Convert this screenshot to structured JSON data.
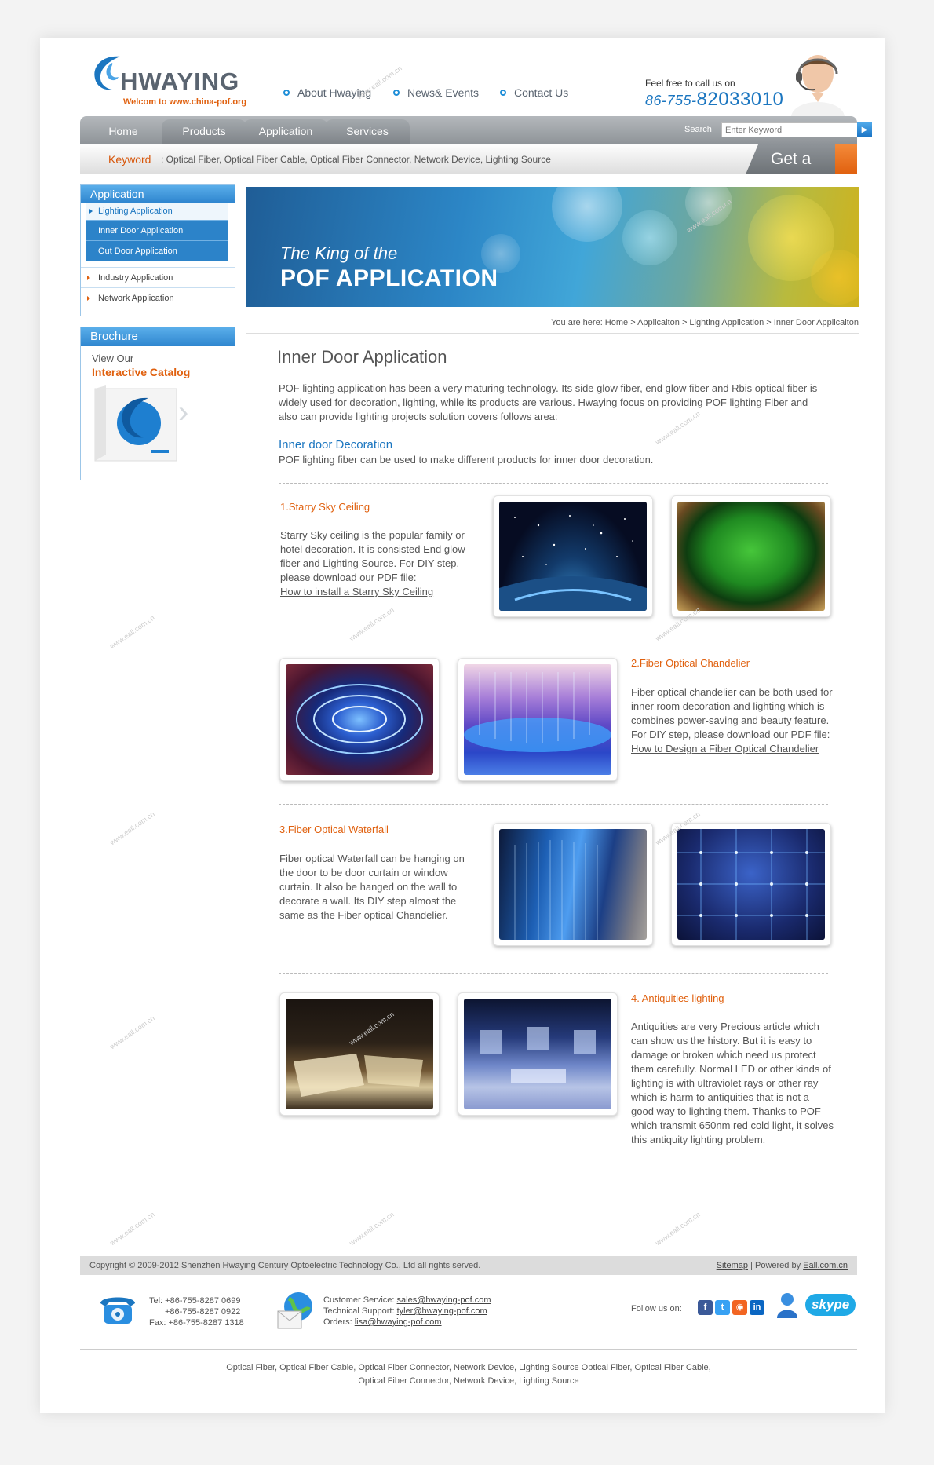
{
  "brand": {
    "name": "HWAYING",
    "welcome": "Welcom to www.china-pof.org"
  },
  "top_nav": [
    "About Hwaying",
    "News& Events",
    "Contact Us"
  ],
  "call": {
    "label": "Feel free to call us on",
    "prefix": "86-755-",
    "number": "82033010"
  },
  "menu": [
    "Home",
    "Products",
    "Application",
    "Services"
  ],
  "search": {
    "label": "Search",
    "placeholder": "Enter Keyword"
  },
  "keyword_bar": {
    "label": "Keyword",
    "text": ": Optical Fiber,  Optical Fiber Cable, Optical Fiber Connector, Network Device, Lighting Source"
  },
  "quote_button": "Get a Quote !",
  "sidebar": {
    "title": "Application",
    "active": "Lighting Application",
    "sub": [
      "Inner Door Application",
      "Out Door Application"
    ],
    "items": [
      "Industry Application",
      "Network Application"
    ]
  },
  "brochure": {
    "title": "Brochure",
    "view": "View Our",
    "catalog": "Interactive Catalog"
  },
  "banner": {
    "line1": "The King of the",
    "line2": "POF APPLICATION"
  },
  "breadcrumb": "You are here: Home > Applicaiton > Lighting Application > Inner Door Applicaiton",
  "page_title": "Inner Door Application",
  "intro": "POF lighting application has been a very maturing technology. Its side glow fiber, end glow fiber and Rbis optical fiber is widely used for decoration, lighting, while its products are various. Hwaying focus on providing POF lighting Fiber and also can provide lighting projects solution covers follows area:",
  "inner_heading": "Inner door Decoration",
  "inner_text": "POF lighting fiber can be used to make different products for inner door decoration.",
  "sections": [
    {
      "title": "1.Starry Sky Ceiling",
      "body": "Starry Sky ceiling is the popular family or hotel decoration. It is consisted End glow fiber and Lighting Source. For DIY step, please download our PDF file:",
      "link": "How to install a Starry Sky Ceiling"
    },
    {
      "title": "2.Fiber Optical Chandelier",
      "body": "Fiber optical chandelier can be both used for inner room decoration and lighting which is combines power-saving and beauty feature. For DIY step, please download our PDF file:",
      "link": "How to Design a Fiber Optical Chandelier"
    },
    {
      "title": "3.Fiber Optical Waterfall",
      "body": "Fiber optical Waterfall can be hanging on the door to be door curtain or window curtain. It also be hanged on the wall to decorate a wall. Its DIY step almost the same as the Fiber optical Chandelier.",
      "link": ""
    },
    {
      "title": "4. Antiquities lighting",
      "body": "Antiquities are very Precious article which can show us the history. But it is easy to damage or broken which need us protect them carefully. Normal LED or other kinds of lighting is with ultraviolet rays or other ray which is harm to antiquities that is not a good way to lighting them. Thanks to POF which transmit 650nm red cold light, it solves this antiquity lighting problem.",
      "link": ""
    }
  ],
  "footer": {
    "copyright": "Copyright © 2009-2012 Shenzhen Hwaying Century Optoelectric Technology Co., Ltd all rights served.",
    "sitemap": "Sitemap",
    "powered_sep": " | Powered by ",
    "powered": "Eall.com.cn",
    "tel": "Tel: +86-755-8287 0699",
    "tel2": "+86-755-8287 0922",
    "fax": "Fax: +86-755-8287 1318",
    "cs_label": "Customer Service: ",
    "cs_email": "sales@hwaying-pof.com",
    "ts_label": "Technical Support: ",
    "ts_email": "tyler@hwaying-pof.com",
    "orders_label": "Orders: ",
    "orders_email": "lisa@hwaying-pof.com",
    "follow": "Follow us on:",
    "skype": "skype",
    "keywords1": "Optical Fiber,  Optical Fiber Cable, Optical Fiber Connector, Network Device, Lighting Source Optical Fiber,  Optical Fiber Cable,",
    "keywords2": "Optical Fiber Connector, Network Device, Lighting Source"
  },
  "watermark": "www.eall.com.cn",
  "colors": {
    "accent_blue": "#1b76c0",
    "accent_orange": "#e0600e",
    "menu_gray": "#8e9398"
  }
}
